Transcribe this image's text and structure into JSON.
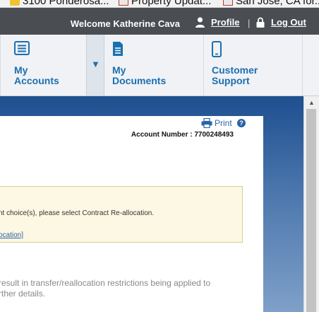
{
  "bookmarks": [
    {
      "label": "3100 Ponderosa...",
      "icon": "bookmark-favicon-icon"
    },
    {
      "label": "Property Updat...",
      "icon": "gmail-icon"
    },
    {
      "label": "San Jose, CA for...",
      "icon": "gmail-icon"
    }
  ],
  "header": {
    "welcome": "Welcome Katherine Cava",
    "profile_label": "Profile",
    "separator": "|",
    "logout_label": "Log Out"
  },
  "nav": {
    "accounts_line1": "My",
    "accounts_line2": "Accounts",
    "dropdown_caret": "▼",
    "documents_line1": "My",
    "documents_line2": "Documents",
    "support_line1": "Customer",
    "support_line2": "Support"
  },
  "content": {
    "print_label": "Print",
    "help_symbol": "?",
    "account_number": "Account Number : 7700248493",
    "notice_line1": "nt choice(s), please select Contract Re-allocation.",
    "notice_link": "ocation]",
    "body_line1": "result in transfer/reallocation restrictions being applied to",
    "body_line2": "rther details."
  },
  "colors": {
    "topbar": "#4a4d52",
    "nav_bg": "#f0f2f5",
    "accent_blue": "#1c6fb0",
    "notice_bg": "#fcf8e3",
    "page_bg_blue": "#1e4f8f"
  }
}
